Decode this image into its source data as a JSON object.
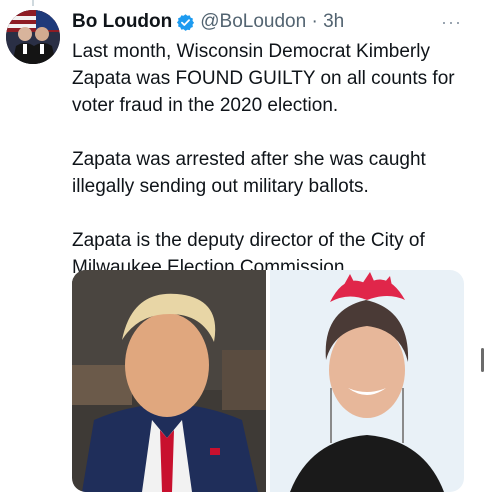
{
  "tweet": {
    "display_name": "Bo Loudon",
    "handle": "@BoLoudon",
    "separator": "·",
    "time": "3h",
    "more_label": "···",
    "paragraphs": [
      "Last month, Wisconsin Democrat Kimberly Zapata was FOUND GUILTY on all counts for voter fraud in the 2020 election.",
      "Zapata was arrested after she was caught illegally sending out military ballots.",
      "Zapata is the deputy director of the City of Milwaukee Election Commission."
    ]
  },
  "colors": {
    "verified": "#1d9bf0",
    "handle": "#536471",
    "text": "#0f1419",
    "left_photo_bg": "#3e3a36",
    "right_photo_bg": "#e9f1f7",
    "hair_accent": "#e0264a"
  },
  "icons": {
    "verified": "verified-badge-icon",
    "more": "more-options-icon"
  }
}
